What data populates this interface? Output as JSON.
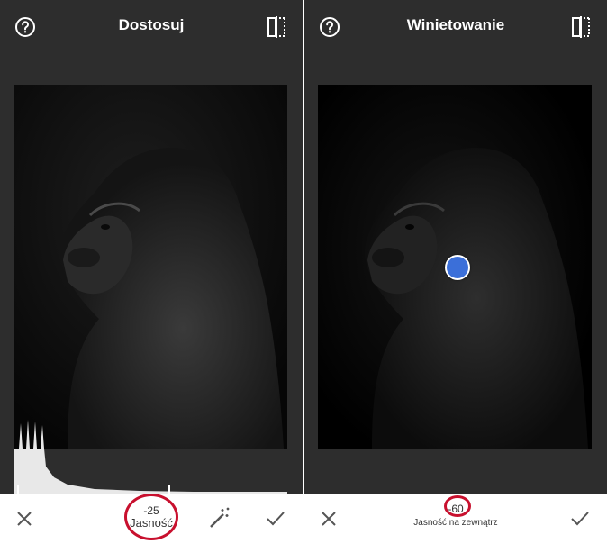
{
  "left_panel": {
    "title": "Dostosuj",
    "adjustment": {
      "value": "-25",
      "label": "Jasność"
    }
  },
  "right_panel": {
    "title": "Winietowanie",
    "adjustment": {
      "value": "-60",
      "label": "Jasność na zewnątrz"
    }
  },
  "icons": {
    "help": "help-icon",
    "compare": "compare-icon",
    "close": "close-icon",
    "apply": "check-icon",
    "auto": "magic-wand-icon"
  },
  "colors": {
    "toolbar_bg": "#2d2d2d",
    "annotation_ring": "#c8102e",
    "vignette_center": "#3b6fd9"
  }
}
